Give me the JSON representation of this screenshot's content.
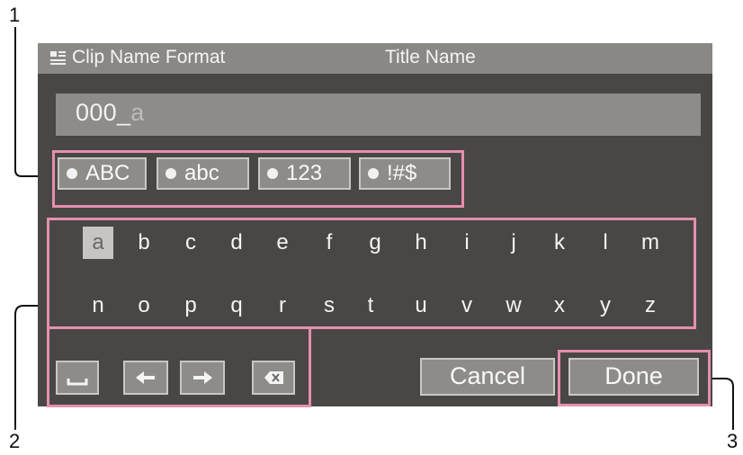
{
  "callouts": [
    "1",
    "2",
    "3"
  ],
  "header": {
    "menu_label": "Clip Name Format",
    "title": "Title Name"
  },
  "name_field": {
    "value": "000_",
    "cursor_char": "a"
  },
  "mode_buttons": [
    {
      "label": "ABC"
    },
    {
      "label": "abc"
    },
    {
      "label": "123"
    },
    {
      "label": "!#$"
    }
  ],
  "keyboard": {
    "row1": [
      "a",
      "b",
      "c",
      "d",
      "e",
      "f",
      "g",
      "h",
      "i",
      "j",
      "k",
      "l",
      "m"
    ],
    "row2": [
      "n",
      "o",
      "p",
      "q",
      "r",
      "s",
      "t",
      "u",
      "v",
      "w",
      "x",
      "y",
      "z"
    ],
    "selected_key": "a"
  },
  "controls": {
    "space_icon": "space-bar-icon",
    "left_icon": "arrow-left-icon",
    "right_icon": "arrow-right-icon",
    "delete_icon": "backspace-icon"
  },
  "actions": {
    "cancel_label": "Cancel",
    "done_label": "Done"
  },
  "colors": {
    "screen_bg": "#494745",
    "titlebar_bg": "#8a8885",
    "button_bg": "#8e8c89",
    "highlight": "#e58fae"
  }
}
